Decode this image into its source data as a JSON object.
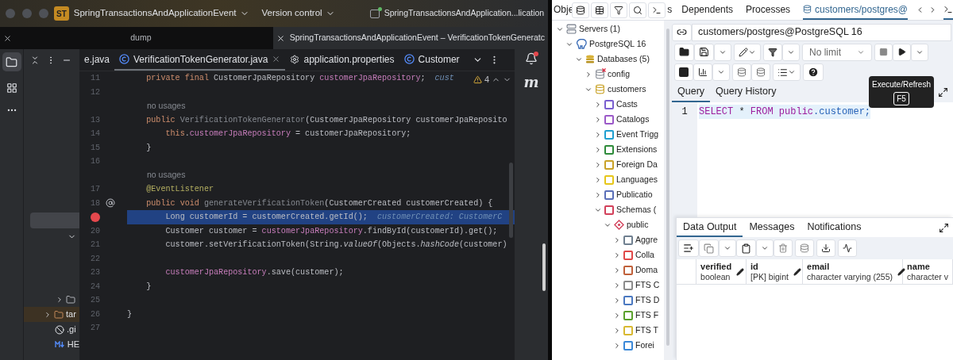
{
  "ide": {
    "title_bar": {
      "project_badge": "ST",
      "project": "SpringTransactionsAndApplicationEvent",
      "vcs": "Version control",
      "run_config": "SpringTransactionsAndApplication...lication"
    },
    "window_tabs": [
      {
        "label": "dump",
        "selected": false
      },
      {
        "label": "SpringTransactionsAndApplicationEvent – VerificationTokenGeneratc",
        "selected": true
      }
    ],
    "editor_tabs": [
      {
        "label": "e.java",
        "selected": false,
        "kind": "plain"
      },
      {
        "label": "VerificationTokenGenerator.java",
        "selected": true,
        "kind": "class"
      },
      {
        "label": "application.properties",
        "selected": false,
        "kind": "settings"
      },
      {
        "label": "Customer",
        "selected": false,
        "kind": "class"
      }
    ],
    "inspections": {
      "count": "4"
    },
    "project_tree": [
      {
        "kind": "blank",
        "selected": true
      },
      {
        "kind": "toggle",
        "expanded": true
      },
      {
        "kind": "folder",
        "expanded": false,
        "selected": false
      },
      {
        "kind": "folder",
        "label": "tar",
        "expanded": false,
        "selected": true
      },
      {
        "kind": "ignore",
        "label": ".gi",
        "selected": false
      },
      {
        "kind": "markdown",
        "label": "HE",
        "selected": false
      }
    ],
    "code_lines": [
      {
        "number": "11",
        "tokens": [
          {
            "text": "    private final ",
            "kind": "kw"
          },
          {
            "text": "CustomerJpaRepository ",
            "kind": "plain"
          },
          {
            "text": "customerJpaRepository",
            "kind": "field"
          },
          {
            "text": ";",
            "kind": "plain"
          }
        ],
        "hint": "cust"
      },
      {
        "number": "12"
      },
      {
        "kind": "inlay",
        "text": "no usages"
      },
      {
        "number": "13",
        "tokens": [
          {
            "text": "    public ",
            "kind": "kw"
          },
          {
            "text": "VerificationTokenGenerator",
            "kind": "unused"
          },
          {
            "text": "(CustomerJpaRepository customerJpaReposito",
            "kind": "plain"
          }
        ]
      },
      {
        "number": "14",
        "tokens": [
          {
            "text": "        this",
            "kind": "kw"
          },
          {
            "text": ".",
            "kind": "plain"
          },
          {
            "text": "customerJpaRepository",
            "kind": "field"
          },
          {
            "text": " = customerJpaRepository;",
            "kind": "plain"
          }
        ]
      },
      {
        "number": "15",
        "tokens": [
          {
            "text": "    }",
            "kind": "plain"
          }
        ]
      },
      {
        "number": "16"
      },
      {
        "kind": "inlay",
        "text": "no usages"
      },
      {
        "number": "17",
        "tokens": [
          {
            "text": "    @EventListener",
            "kind": "ann"
          }
        ]
      },
      {
        "number": "18",
        "gutter_icon": true,
        "tokens": [
          {
            "text": "    public void ",
            "kind": "kw"
          },
          {
            "text": "generateVerificationToken",
            "kind": "unused"
          },
          {
            "text": "(CustomerCreated customerCreated) {",
            "kind": "plain"
          }
        ]
      },
      {
        "breakpoint": true,
        "selected": true,
        "tokens": [
          {
            "text": "        Long customerId = customerCreated.getId();",
            "kind": "plain"
          }
        ],
        "hint": "customerCreated: CustomerC"
      },
      {
        "number": "20",
        "tokens": [
          {
            "text": "        Customer customer = ",
            "kind": "plain"
          },
          {
            "text": "customerJpaRepository",
            "kind": "field"
          },
          {
            "text": ".findById(customerId).get();",
            "kind": "plain"
          }
        ]
      },
      {
        "number": "21",
        "tokens": [
          {
            "text": "        customer.setVerificationToken(String.",
            "kind": "plain"
          },
          {
            "text": "valueOf",
            "kind": "italic"
          },
          {
            "text": "(Objects.",
            "kind": "plain"
          },
          {
            "text": "hashCode",
            "kind": "italic"
          },
          {
            "text": "(customer)",
            "kind": "plain"
          }
        ]
      },
      {
        "number": "22"
      },
      {
        "number": "23",
        "tokens": [
          {
            "text": "        customerJpaRepository",
            "kind": "field"
          },
          {
            "text": ".save(customer);",
            "kind": "plain"
          }
        ]
      },
      {
        "number": "24",
        "tokens": [
          {
            "text": "    }",
            "kind": "plain"
          }
        ]
      },
      {
        "number": "25"
      },
      {
        "number": "26",
        "tokens": [
          {
            "text": "}",
            "kind": "plain"
          }
        ]
      },
      {
        "number": "27"
      }
    ],
    "right_strip": {
      "maven": "m",
      "notification": true
    }
  },
  "pgadmin": {
    "tabs": [
      {
        "label": "Obje",
        "selected": false
      },
      {
        "label": "s",
        "selected": false
      },
      {
        "label": "Dependents",
        "selected": false
      },
      {
        "label": "Processes",
        "selected": false
      },
      {
        "label": "customers/postgres@",
        "selected": true
      }
    ],
    "tree": [
      {
        "label": "Servers (1)",
        "kind": "servers",
        "expanded": true,
        "children": [
          {
            "label": "PostgreSQL 16",
            "kind": "server",
            "expanded": true,
            "children": [
              {
                "label": "Databases (5)",
                "kind": "databases",
                "expanded": true,
                "children": [
                  {
                    "label": "config",
                    "kind": "database-disconnected",
                    "expanded": false
                  },
                  {
                    "label": "customers",
                    "kind": "database",
                    "expanded": true,
                    "children": [
                      {
                        "label": "Casts",
                        "kind": "object",
                        "color": "#7a5fd0",
                        "expanded": false
                      },
                      {
                        "label": "Catalogs",
                        "kind": "object",
                        "color": "#9b59c8",
                        "expanded": false
                      },
                      {
                        "label": "Event Trigg",
                        "kind": "object",
                        "color": "#1f9fd0",
                        "expanded": false
                      },
                      {
                        "label": "Extensions",
                        "kind": "object",
                        "color": "#2e8b3a",
                        "expanded": false
                      },
                      {
                        "label": "Foreign Da",
                        "kind": "object",
                        "color": "#c9a227",
                        "expanded": false
                      },
                      {
                        "label": "Languages",
                        "kind": "object",
                        "color": "#e6c619",
                        "expanded": false
                      },
                      {
                        "label": "Publicatio",
                        "kind": "object",
                        "color": "#5a6fb8",
                        "expanded": false
                      },
                      {
                        "label": "Schemas (",
                        "kind": "object",
                        "color": "#d2405a",
                        "expanded": true,
                        "children": [
                          {
                            "label": "public",
                            "kind": "schema",
                            "expanded": true,
                            "children": [
                              {
                                "label": "Aggre",
                                "kind": "object",
                                "color": "#6f7f8f",
                                "expanded": false
                              },
                              {
                                "label": "Colla",
                                "kind": "object",
                                "color": "#e04848",
                                "expanded": false
                              },
                              {
                                "label": "Doma",
                                "kind": "object",
                                "color": "#c0603a",
                                "expanded": false
                              },
                              {
                                "label": "FTS C",
                                "kind": "object",
                                "color": "#8a8a8a",
                                "expanded": false
                              },
                              {
                                "label": "FTS D",
                                "kind": "object",
                                "color": "#4a78c0",
                                "expanded": false
                              },
                              {
                                "label": "FTS F",
                                "kind": "object",
                                "color": "#5aa02c",
                                "expanded": false
                              },
                              {
                                "label": "FTS T",
                                "kind": "object",
                                "color": "#d8b830",
                                "expanded": false
                              },
                              {
                                "label": "Forei",
                                "kind": "object",
                                "color": "#3a88d8",
                                "expanded": false
                              }
                            ]
                          }
                        ]
                      }
                    ]
                  }
                ]
              }
            ]
          }
        ]
      }
    ],
    "connection": "customers/postgres@PostgreSQL 16",
    "row_limit": "No limit",
    "tooltip": {
      "title": "Execute/Refresh",
      "shortcut": "F5"
    },
    "query_tabs": [
      {
        "label": "Query",
        "selected": true
      },
      {
        "label": "Query History",
        "selected": false
      }
    ],
    "sql_lines": [
      {
        "number": "1",
        "tokens": [
          {
            "text": "SELECT",
            "kind": "keyword"
          },
          {
            "text": " * ",
            "kind": "operator"
          },
          {
            "text": "FROM",
            "kind": "keyword"
          },
          {
            "text": " public",
            "kind": "keyword"
          },
          {
            "text": ".customer;",
            "kind": "identifier"
          }
        ]
      }
    ],
    "output_tabs": [
      {
        "label": "Data Output",
        "selected": true
      },
      {
        "label": "Messages",
        "selected": false
      },
      {
        "label": "Notifications",
        "selected": false
      }
    ],
    "columns": [
      {
        "name": "verified",
        "type": "boolean"
      },
      {
        "name": "id",
        "type": "[PK] bigint"
      },
      {
        "name": "email",
        "type": "character varying (255)"
      },
      {
        "name": "name",
        "type": "character v"
      }
    ]
  }
}
